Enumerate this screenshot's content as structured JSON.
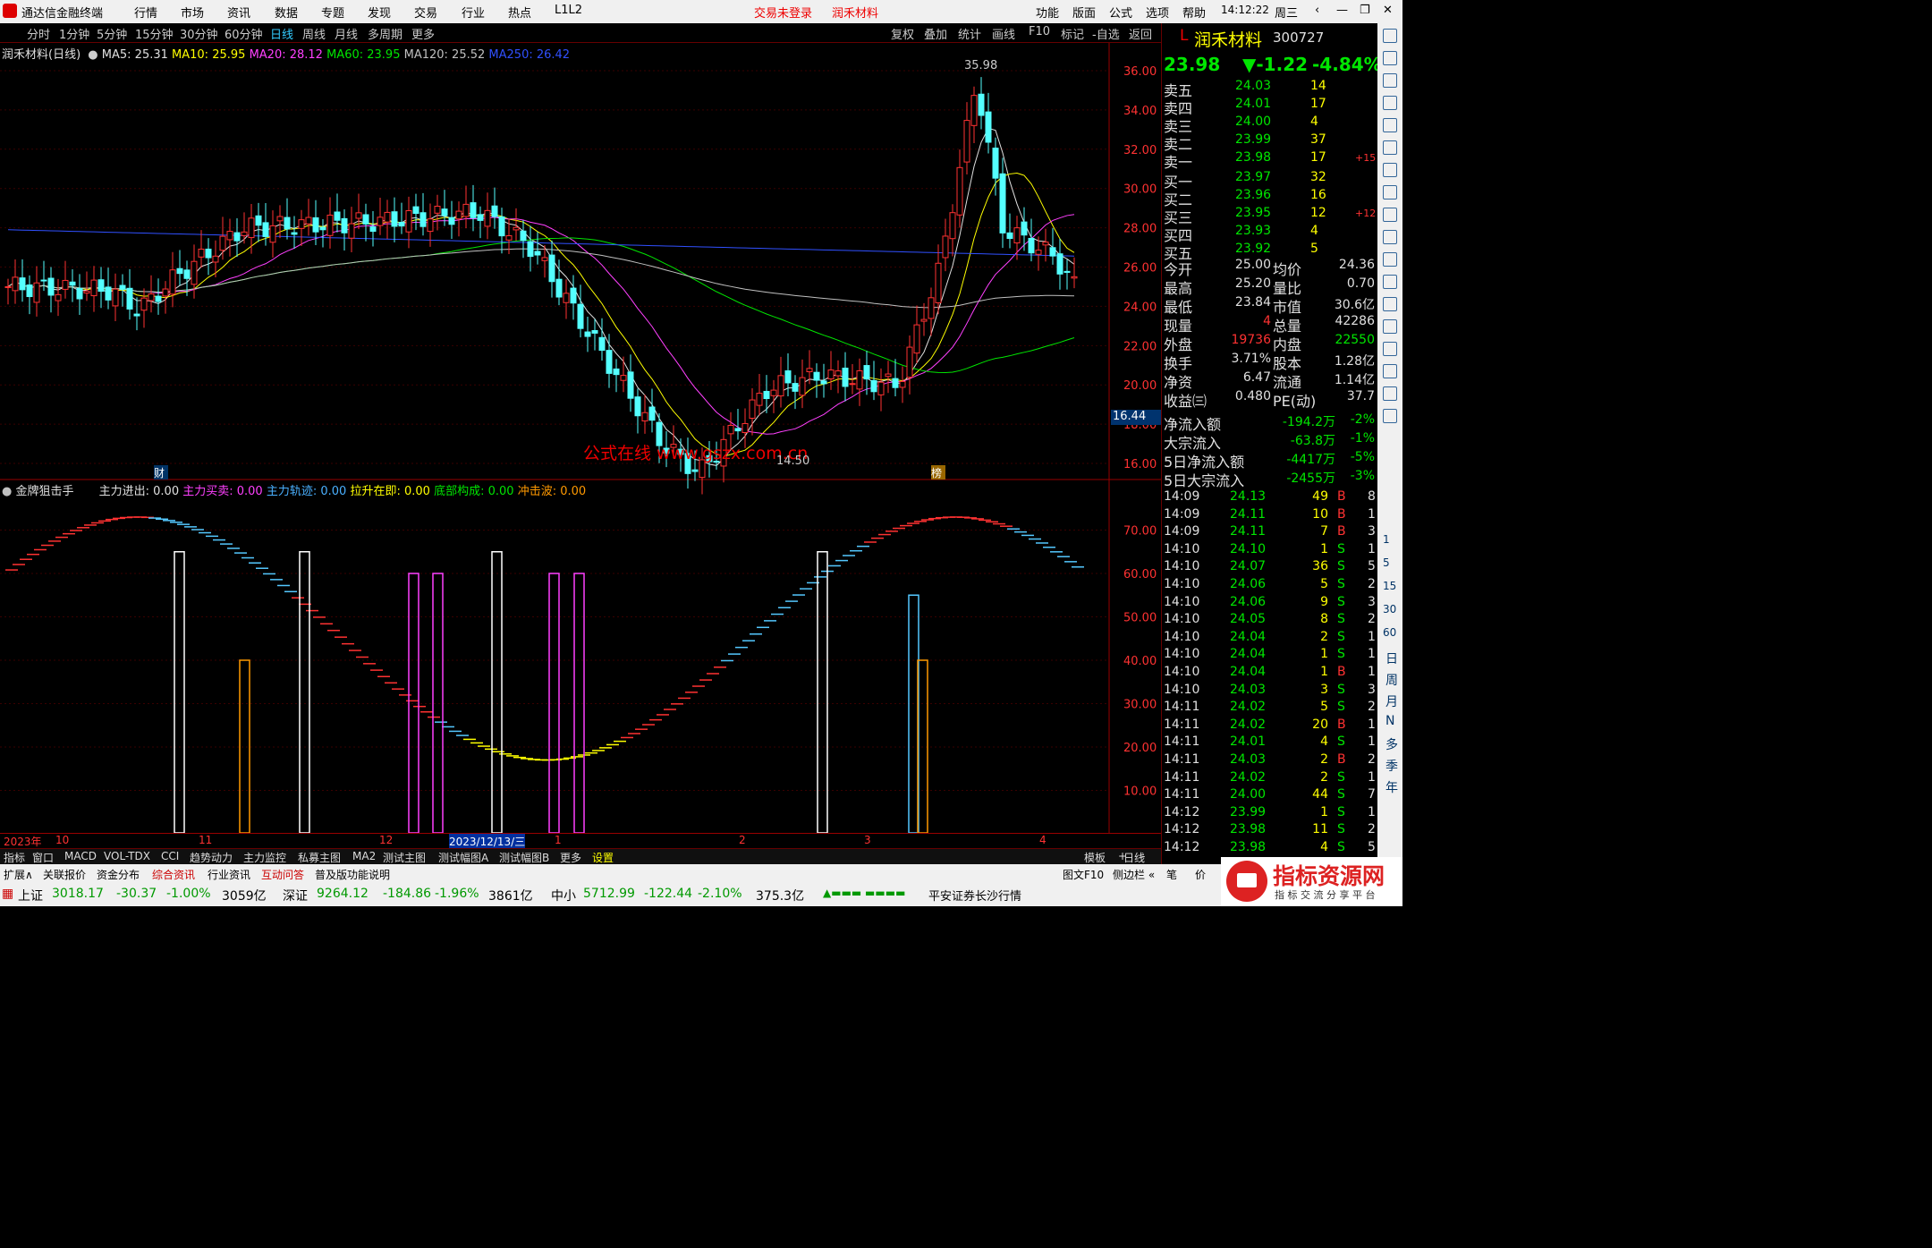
{
  "app": {
    "title": "通达信金融终端",
    "menus": [
      "行情",
      "市场",
      "资讯",
      "数据",
      "专题",
      "发现",
      "交易",
      "行业",
      "热点",
      "L1L2"
    ],
    "notice": "交易未登录",
    "stock_link": "润禾材料",
    "right_menus": [
      "功能",
      "版面",
      "公式",
      "选项",
      "帮助"
    ],
    "time": "14:12:22",
    "weekday": "周三"
  },
  "period_tabs": [
    "分时",
    "1分钟",
    "5分钟",
    "15分钟",
    "30分钟",
    "60分钟",
    "日线",
    "周线",
    "月线",
    "多周期",
    "更多"
  ],
  "tool_tabs": [
    "复权",
    "叠加",
    "统计",
    "画线",
    "F10",
    "标记",
    "-自选",
    "返回"
  ],
  "ma": {
    "label": "润禾材料(日线)",
    "ma5": "MA5: 25.31",
    "ma10": "MA10: 25.95",
    "ma20": "MA20: 28.12",
    "ma60": "MA60: 23.95",
    "ma120": "MA120: 25.52",
    "ma250": "MA250: 26.42"
  },
  "ind": {
    "name": "金牌狙击手",
    "a": "主力进出: 0.00",
    "b": "主力买卖: 0.00",
    "c": "主力轨迹: 0.00",
    "d": "拉升在即: 0.00",
    "e": "底部构成: 0.00",
    "f": "冲击波: 0.00"
  },
  "chart_data": {
    "type": "candlestick",
    "ylim": [
      15,
      36.5
    ],
    "y_ticks": [
      "36.00",
      "34.00",
      "32.00",
      "30.00",
      "28.00",
      "26.00",
      "24.00",
      "22.00",
      "20.00",
      "18.00",
      "16.00"
    ],
    "hi_label": "35.98",
    "lo_label": "14.50",
    "price_label": "16.44",
    "watermark": "公式在线  www.gszx.com.cn",
    "marks": [
      "财",
      "榜"
    ],
    "ind_ticks": [
      "70.00",
      "60.00",
      "50.00",
      "40.00",
      "30.00",
      "20.00",
      "10.00"
    ],
    "x_labels": [
      "2023年",
      "10",
      "11",
      "12",
      "2023/12/13/三",
      "1",
      "2",
      "3",
      "4"
    ]
  },
  "quote": {
    "name": "润禾材料",
    "code": "300727",
    "price": "23.98",
    "chg": "▼-1.22",
    "pct": "-4.84%",
    "asks": [
      [
        "卖五",
        "24.03",
        "14",
        ""
      ],
      [
        "卖四",
        "24.01",
        "17",
        ""
      ],
      [
        "卖三",
        "24.00",
        "4",
        ""
      ],
      [
        "卖二",
        "23.99",
        "37",
        ""
      ],
      [
        "卖一",
        "23.98",
        "17",
        "+15"
      ]
    ],
    "bids": [
      [
        "买一",
        "23.97",
        "32",
        ""
      ],
      [
        "买二",
        "23.96",
        "16",
        ""
      ],
      [
        "买三",
        "23.95",
        "12",
        "+12"
      ],
      [
        "买四",
        "23.93",
        "4",
        ""
      ],
      [
        "买五",
        "23.92",
        "5",
        ""
      ]
    ],
    "stats": [
      [
        "今开",
        "25.00",
        "均价",
        "24.36"
      ],
      [
        "最高",
        "25.20",
        "量比",
        "0.70"
      ],
      [
        "最低",
        "23.84",
        "市值",
        "30.6亿"
      ],
      [
        "现量",
        "4",
        "总量",
        "42286"
      ],
      [
        "外盘",
        "19736",
        "内盘",
        "22550"
      ],
      [
        "换手",
        "3.71%",
        "股本",
        "1.28亿"
      ],
      [
        "净资",
        "6.47",
        "流通",
        "1.14亿"
      ],
      [
        "收益㈢",
        "0.480",
        "PE(动)",
        "37.7"
      ]
    ],
    "flows": [
      [
        "净流入额",
        "-194.2万",
        "-2%"
      ],
      [
        "大宗流入",
        "-63.8万",
        "-1%"
      ],
      [
        "5日净流入额",
        "-4417万",
        "-5%"
      ],
      [
        "5日大宗流入",
        "-2455万",
        "-3%"
      ]
    ],
    "ticks": [
      [
        "14:09",
        "24.13",
        "49",
        "B",
        "8"
      ],
      [
        "14:09",
        "24.11",
        "10",
        "B",
        "1"
      ],
      [
        "14:09",
        "24.11",
        "7",
        "B",
        "3"
      ],
      [
        "14:10",
        "24.10",
        "1",
        "S",
        "1"
      ],
      [
        "14:10",
        "24.07",
        "36",
        "S",
        "5"
      ],
      [
        "14:10",
        "24.06",
        "5",
        "S",
        "2"
      ],
      [
        "14:10",
        "24.06",
        "9",
        "S",
        "3"
      ],
      [
        "14:10",
        "24.05",
        "8",
        "S",
        "2"
      ],
      [
        "14:10",
        "24.04",
        "2",
        "S",
        "1"
      ],
      [
        "14:10",
        "24.04",
        "1",
        "S",
        "1"
      ],
      [
        "14:10",
        "24.04",
        "1",
        "B",
        "1"
      ],
      [
        "14:10",
        "24.03",
        "3",
        "S",
        "3"
      ],
      [
        "14:11",
        "24.02",
        "5",
        "S",
        "2"
      ],
      [
        "14:11",
        "24.02",
        "20",
        "B",
        "1"
      ],
      [
        "14:11",
        "24.01",
        "4",
        "S",
        "1"
      ],
      [
        "14:11",
        "24.03",
        "2",
        "B",
        "2"
      ],
      [
        "14:11",
        "24.02",
        "2",
        "S",
        "1"
      ],
      [
        "14:11",
        "24.00",
        "44",
        "S",
        "7"
      ],
      [
        "14:12",
        "23.99",
        "1",
        "S",
        "1"
      ],
      [
        "14:12",
        "23.98",
        "11",
        "S",
        "2"
      ],
      [
        "14:12",
        "23.98",
        "4",
        "S",
        "5"
      ]
    ]
  },
  "side_icons": [
    "日",
    "周",
    "月",
    "N",
    "多",
    "季",
    "年"
  ],
  "side_nums": [
    "1",
    "5",
    "15",
    "30",
    "60"
  ],
  "bottom_tabs": [
    "指标",
    "窗口",
    "MACD",
    "VOL-TDX",
    "CCI",
    "趋势动力",
    "主力监控",
    "私募主图",
    "MA2",
    "测试主图",
    "测试幅图A",
    "测试幅图B",
    "更多",
    "设置"
  ],
  "bottom_right": [
    "模板",
    "+",
    "-",
    "日线"
  ],
  "bottom2": [
    "扩展∧",
    "关联报价",
    "资金分布",
    "综合资讯",
    "行业资讯",
    "互动问答",
    "普及版功能说明",
    "图文F10",
    "侧边栏 «",
    "笔",
    "价"
  ],
  "status": {
    "sh": "上证",
    "sh_v": "3018.17",
    "sh_c": "-30.37",
    "sh_p": "-1.00%",
    "sh_a": "3059亿",
    "sz": "深证",
    "sz_v": "9264.12",
    "sz_c": "-184.86",
    "sz_p": "-1.96%",
    "sz_a": "3861亿",
    "zx": "中小",
    "zx_v": "5712.99",
    "zx_c": "-122.44",
    "zx_p": "-2.10%",
    "zx_a": "375.3亿",
    "broker": "平安证券长沙行情"
  },
  "brand": {
    "name": "指标资源网",
    "sub": "指 标 交 流 分 享 平 台"
  }
}
